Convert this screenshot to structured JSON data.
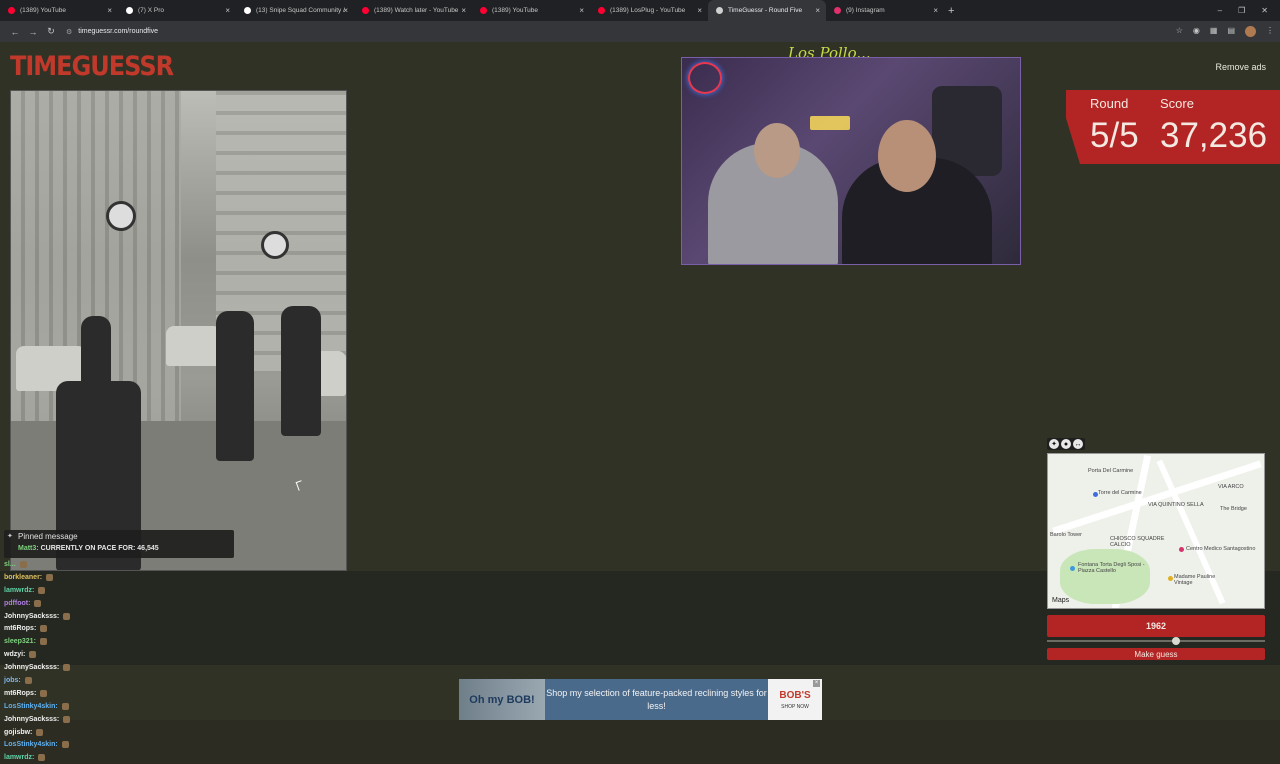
{
  "browser": {
    "tabs": [
      {
        "label": "(1389) YouTube",
        "favicon_color": "#ff0033",
        "active": false
      },
      {
        "label": "(7) X Pro",
        "favicon_color": "#ffffff",
        "active": false
      },
      {
        "label": "(13) Snipe Squad Community /",
        "favicon_color": "#ffffff",
        "active": false
      },
      {
        "label": "(1389) Watch later - YouTube",
        "favicon_color": "#ff0033",
        "active": false
      },
      {
        "label": "(1389) YouTube",
        "favicon_color": "#ff0033",
        "active": false
      },
      {
        "label": "(1389) LosPlug - YouTube",
        "favicon_color": "#ff0033",
        "active": false
      },
      {
        "label": "TimeGuessr - Round Five",
        "favicon_color": "#d0d0d0",
        "active": true
      },
      {
        "label": "(9) Instagram",
        "favicon_color": "#e1306c",
        "active": false
      }
    ],
    "url": "timeguessr.com/roundfive"
  },
  "page": {
    "logo": "TIMEGUESSR",
    "remove_ads": "Remove ads",
    "signature": "Los Pollo...",
    "round_label": "Round",
    "score_label": "Score",
    "round_value": "5/5",
    "score_value": "37,236",
    "year_value": "1962",
    "year_slider_fraction": 0.59,
    "make_guess": "Make guess"
  },
  "map": {
    "labels": [
      "Porta Del Carmine",
      "Torre del Carmine",
      "VIA QUINTINO SELLA",
      "VIA ARCO",
      "The Bridge",
      "Barolo Tower",
      "CHIOSCO SQUADRE CALCIO",
      "Centro Medico Santagostino",
      "Fontana Torta Degli Sposi - Piazza Castello",
      "Madame Pauline Vintage",
      "Maps"
    ]
  },
  "chat": {
    "pinned_title": "Pinned message",
    "pinned_user": "Matt3:",
    "pinned_text": "CURRENTLY ON PACE FOR: 46,545",
    "messages": [
      {
        "user": "sl...",
        "color": "#7fd17f"
      },
      {
        "user": "borkleaner:",
        "color": "#e0c060"
      },
      {
        "user": "lamwrdz:",
        "color": "#5fd3a8"
      },
      {
        "user": "pdffoot:",
        "color": "#b07fe0"
      },
      {
        "user": "JohnnySacksss:",
        "color": "#f0f0f0"
      },
      {
        "user": "mt6Rops:",
        "color": "#f0f0f0"
      },
      {
        "user": "sleep321:",
        "color": "#7fd17f"
      },
      {
        "user": "wdzyi:",
        "color": "#f0f0f0"
      },
      {
        "user": "JohnnySacksss:",
        "color": "#f0f0f0"
      },
      {
        "user": "jobs:",
        "color": "#7fb7f0"
      },
      {
        "user": "mt6Rops:",
        "color": "#f0f0f0"
      },
      {
        "user": "LosStinky4skin:",
        "color": "#5fb0f0"
      },
      {
        "user": "JohnnySacksss:",
        "color": "#f0f0f0"
      },
      {
        "user": "gojisbw:",
        "color": "#f0f0f0"
      },
      {
        "user": "LosStinky4skin:",
        "color": "#5fb0f0"
      },
      {
        "user": "lamwrdz:",
        "color": "#5fd3a8"
      }
    ]
  },
  "ad": {
    "logo_text": "Oh my BOB!",
    "headline": "Shop my selection of feature-packed reclining styles for less!",
    "brand": "BOB'S",
    "cta": "SHOP NOW"
  }
}
